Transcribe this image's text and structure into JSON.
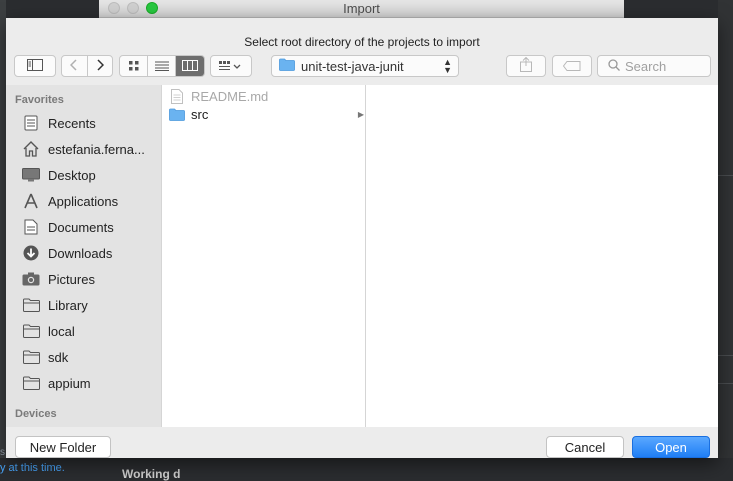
{
  "window": {
    "title": "Import"
  },
  "dialog": {
    "message": "Select root directory of the projects to import"
  },
  "toolbar": {
    "path_popup": "unit-test-java-junit",
    "search_placeholder": "Search",
    "icons": [
      "sidebar-toggle-icon",
      "back-icon",
      "forward-icon",
      "icon-view-icon",
      "list-view-icon",
      "column-view-icon",
      "arrange-icon",
      "share-icon",
      "tag-icon",
      "search-icon"
    ],
    "active_view": "columns"
  },
  "sidebar": {
    "favorites_header": "Favorites",
    "devices_header": "Devices",
    "items": [
      {
        "label": "Recents",
        "icon": "recents-icon"
      },
      {
        "label": "estefania.ferna...",
        "icon": "home-icon"
      },
      {
        "label": "Desktop",
        "icon": "desktop-icon"
      },
      {
        "label": "Applications",
        "icon": "applications-icon"
      },
      {
        "label": "Documents",
        "icon": "documents-icon"
      },
      {
        "label": "Downloads",
        "icon": "downloads-icon"
      },
      {
        "label": "Pictures",
        "icon": "pictures-icon"
      },
      {
        "label": "Library",
        "icon": "folder-icon"
      },
      {
        "label": "local",
        "icon": "folder-icon"
      },
      {
        "label": "sdk",
        "icon": "folder-icon"
      },
      {
        "label": "appium",
        "icon": "folder-icon"
      }
    ]
  },
  "browser": {
    "column1": [
      {
        "name": "README.md",
        "type": "file",
        "enabled": false
      },
      {
        "name": "src",
        "type": "folder",
        "enabled": true
      }
    ]
  },
  "buttons": {
    "new_folder": "New Folder",
    "cancel": "Cancel",
    "open": "Open"
  },
  "background": {
    "status_fragment": "s",
    "status_blue": "y at this time.",
    "working_label": "Working d"
  },
  "colors": {
    "accent": "#1f7ef5",
    "folder": "#6ab3f0",
    "zoom": "#28c840"
  }
}
